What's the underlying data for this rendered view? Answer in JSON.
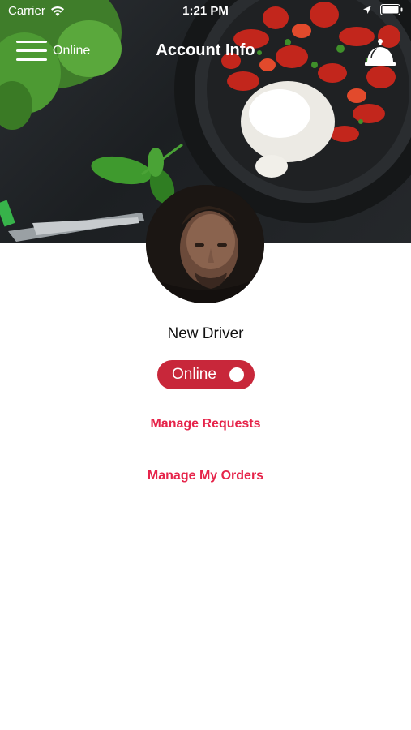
{
  "status_bar": {
    "carrier": "Carrier",
    "time": "1:21 PM"
  },
  "header": {
    "menu_status_label": "Online",
    "title": "Account Info"
  },
  "profile": {
    "name": "New Driver"
  },
  "availability_toggle": {
    "label": "Online",
    "state": "on"
  },
  "actions": {
    "manage_requests": "Manage Requests",
    "manage_my_orders": "Manage My Orders"
  },
  "colors": {
    "accent": "#e6244a",
    "toggle_background": "#c8273a",
    "text_primary": "#111111"
  },
  "icons": {
    "menu": "hamburger-icon",
    "notifications": "service-bell-icon",
    "wifi": "wifi-icon",
    "location": "location-arrow-icon",
    "battery": "battery-icon"
  }
}
